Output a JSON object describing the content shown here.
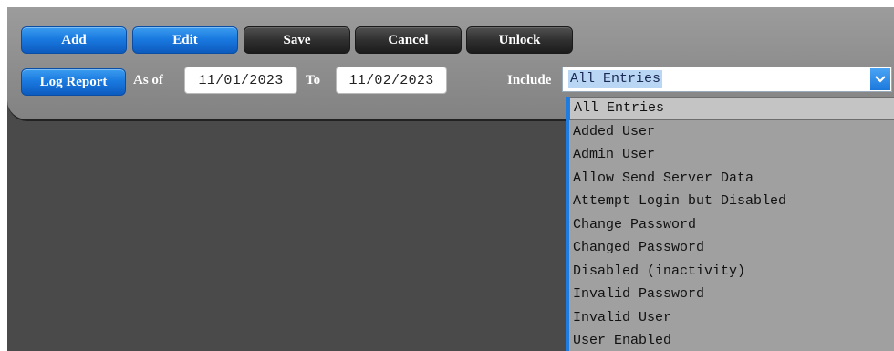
{
  "toolbar": {
    "add_label": "Add",
    "edit_label": "Edit",
    "save_label": "Save",
    "cancel_label": "Cancel",
    "unlock_label": "Unlock"
  },
  "report": {
    "log_report_label": "Log Report",
    "as_of_label": "As of",
    "from_date": "11/01/2023",
    "to_label": "To",
    "to_date": "11/02/2023",
    "include_label": "Include",
    "include_selected": "All Entries",
    "include_options": [
      "All Entries",
      "Added User",
      "Admin User",
      "Allow Send Server Data",
      "Attempt Login but Disabled",
      "Change Password",
      "Changed Password",
      "Disabled (inactivity)",
      "Invalid Password",
      "Invalid User",
      "User Enabled"
    ]
  },
  "colors": {
    "primary_button": "#1a7ae0",
    "dark_button": "#303030",
    "toolbar_bg": "#8c8c8c",
    "content_bg": "#4a4a4a",
    "dropdown_bg": "#a0a0a0",
    "selection_highlight": "#b9d7f5"
  },
  "icons": {
    "dropdown_arrow": "chevron-down-icon"
  }
}
